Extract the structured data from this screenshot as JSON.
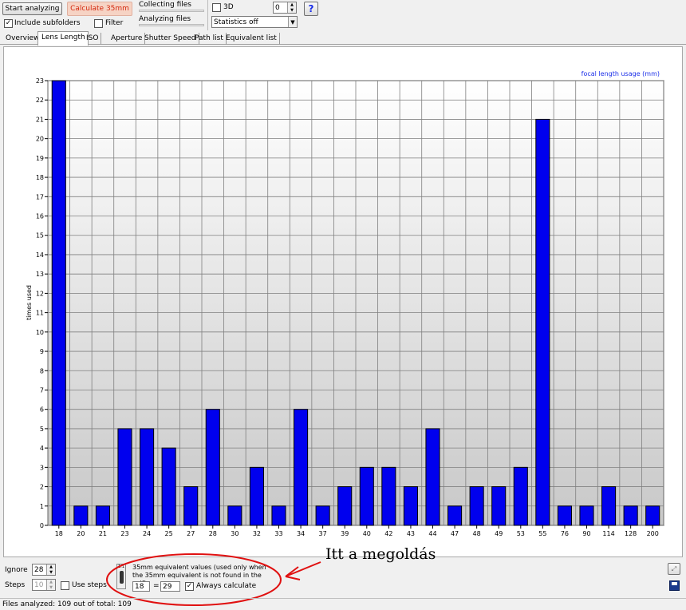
{
  "toolbar": {
    "start_label": "Start analyzing",
    "calc_label": "Calculate 35mm",
    "include_sub_label": "Include subfolders",
    "include_sub_checked": true,
    "filter_label": "Filter",
    "filter_checked": false,
    "collecting_label": "Collecting files",
    "analyzing_label": "Analyzing files",
    "three_d_label": "3D",
    "three_d_checked": false,
    "spin_value": "0",
    "stats_option": "Statistics off",
    "help_label": "?"
  },
  "tabs": [
    "Overview",
    "Lens Length",
    "ISO",
    "Aperture",
    "Shutter Speed",
    "Path list",
    "Equivalent list"
  ],
  "active_tab": 1,
  "chart_data": {
    "type": "bar",
    "title": "focal length usage (mm)",
    "ylabel": "times used",
    "xlabel": "",
    "categories": [
      "18",
      "20",
      "21",
      "23",
      "24",
      "25",
      "27",
      "28",
      "30",
      "32",
      "33",
      "34",
      "37",
      "39",
      "40",
      "42",
      "43",
      "44",
      "47",
      "48",
      "49",
      "53",
      "55",
      "76",
      "90",
      "114",
      "128",
      "200"
    ],
    "values": [
      23,
      1,
      1,
      5,
      5,
      4,
      2,
      6,
      1,
      3,
      1,
      6,
      1,
      2,
      3,
      3,
      2,
      5,
      1,
      2,
      2,
      3,
      21,
      1,
      1,
      2,
      1,
      1
    ],
    "ylim": [
      0,
      23
    ],
    "yticks": [
      "0",
      "1",
      "2",
      "3",
      "4",
      "5",
      "6",
      "7",
      "8",
      "9",
      "10",
      "11",
      "12",
      "13",
      "14",
      "15",
      "16",
      "17",
      "18",
      "19",
      "20",
      "21",
      "22",
      "23"
    ],
    "grid": true,
    "bar_color": "#0000ee"
  },
  "bottom": {
    "ignore_label": "Ignore",
    "ignore_value": "28",
    "steps_label": "Steps",
    "steps_value": "10",
    "use_steps_label": "Use steps",
    "use_steps_checked": false,
    "mm_badge": "1:1",
    "equiv_text": "35mm equivalent values (used only when the 35mm equivalent is not found in the exif).",
    "equiv_from": "18",
    "equiv_eq": "=",
    "equiv_to": "29",
    "always_calc_label": "Always calculate",
    "always_calc_checked": true
  },
  "annotation": {
    "text": "Itt a megoldás",
    "color": "#e01010"
  },
  "status": {
    "text": "Files analyzed: 109 out of total: 109"
  }
}
